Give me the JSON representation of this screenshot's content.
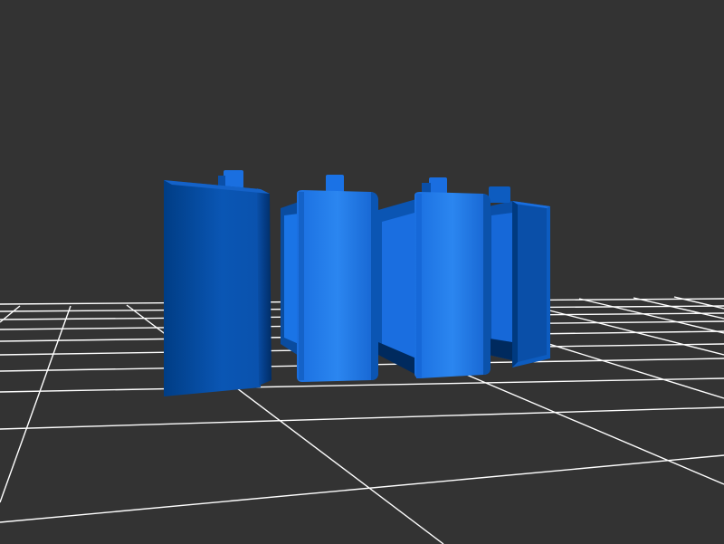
{
  "viewer": {
    "background_color": "#333333",
    "grid_color": "#ffffff",
    "model_color_base": "#1565d8",
    "model_color_light": "#2b85ee",
    "model_color_dark": "#003a80",
    "model_color_shadow": "#002a5e",
    "grid_visible": true,
    "model_part_count": 4
  }
}
